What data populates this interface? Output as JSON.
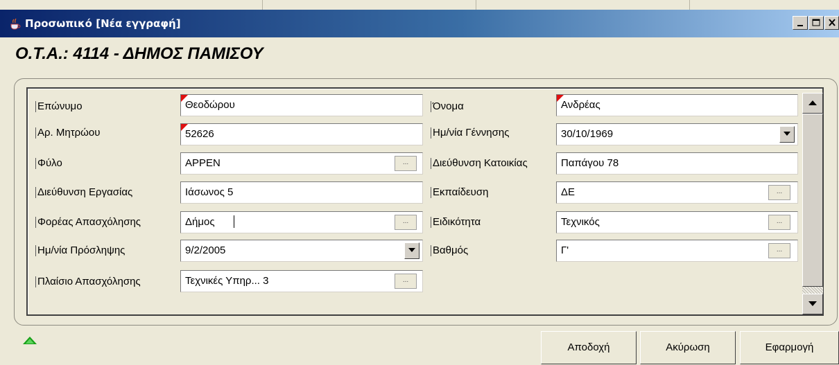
{
  "window": {
    "title": "Προσωπικό [Νέα εγγραφή]"
  },
  "header": {
    "title": "Ο.Τ.Α.: 4114 - ΔΗΜΟΣ ΠΑΜΙΣΟΥ"
  },
  "form": {
    "surname": {
      "label": "Επώνυμο",
      "value": "Θεοδώρου",
      "required": true
    },
    "first_name": {
      "label": "Όνομα",
      "value": "Ανδρέας",
      "required": true
    },
    "registry_no": {
      "label": "Αρ. Μητρώου",
      "value": "52626",
      "required": true
    },
    "birth_date": {
      "label": "Ημ/νία Γέννησης",
      "value": "30/10/1969"
    },
    "gender": {
      "label": "Φύλο",
      "value": "ΑΡΡΕΝ"
    },
    "home_address": {
      "label": "Διεύθυνση Κατοικίας",
      "value": "Παπάγου 78"
    },
    "work_address": {
      "label": "Διεύθυνση Εργασίας",
      "value": "Ιάσωνος 5"
    },
    "education": {
      "label": "Εκπαίδευση",
      "value": "ΔΕ"
    },
    "employer": {
      "label": "Φορέας Απασχόλησης",
      "value": "Δήμος"
    },
    "specialty": {
      "label": "Ειδικότητα",
      "value": "Τεχνικός"
    },
    "hire_date": {
      "label": "Ημ/νία Πρόσληψης",
      "value": "9/2/2005"
    },
    "grade": {
      "label": "Βαθμός",
      "value": "Γ'"
    },
    "employment_frame": {
      "label": "Πλαίσιο Απασχόλησης",
      "value": "Τεχνικές Υπηρ... 3"
    },
    "lookup_button_label": "..."
  },
  "buttons": {
    "accept": "Αποδοχή",
    "cancel": "Ακύρωση",
    "apply": "Εφαρμογή"
  },
  "colors": {
    "title_bar_start": "#0a246a",
    "title_bar_end": "#a6caf0",
    "required_marker": "#e01010",
    "collapse_arrow": "#18a018",
    "window_bg": "#ece9d8"
  },
  "icons": {
    "app": "java-cup-icon",
    "minimize": "minimize-icon",
    "maximize": "maximize-icon",
    "close": "close-icon",
    "collapse": "triangle-up-icon",
    "dropdown": "chevron-down-icon",
    "scroll_up": "scroll-up-icon",
    "scroll_down": "scroll-down-icon"
  }
}
